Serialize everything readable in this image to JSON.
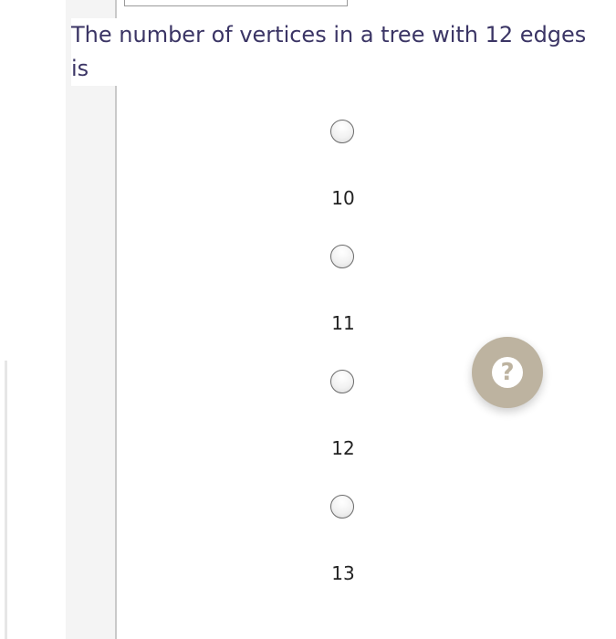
{
  "question": {
    "text": "The number of vertices in a tree with 12 edges is"
  },
  "options": [
    {
      "label": "10"
    },
    {
      "label": "11"
    },
    {
      "label": "12"
    },
    {
      "label": "13"
    }
  ],
  "help_button": {
    "icon": "question-mark-icon",
    "glyph": "?",
    "color": "#bdb3a0"
  },
  "colors": {
    "question_text": "#3b3565"
  }
}
